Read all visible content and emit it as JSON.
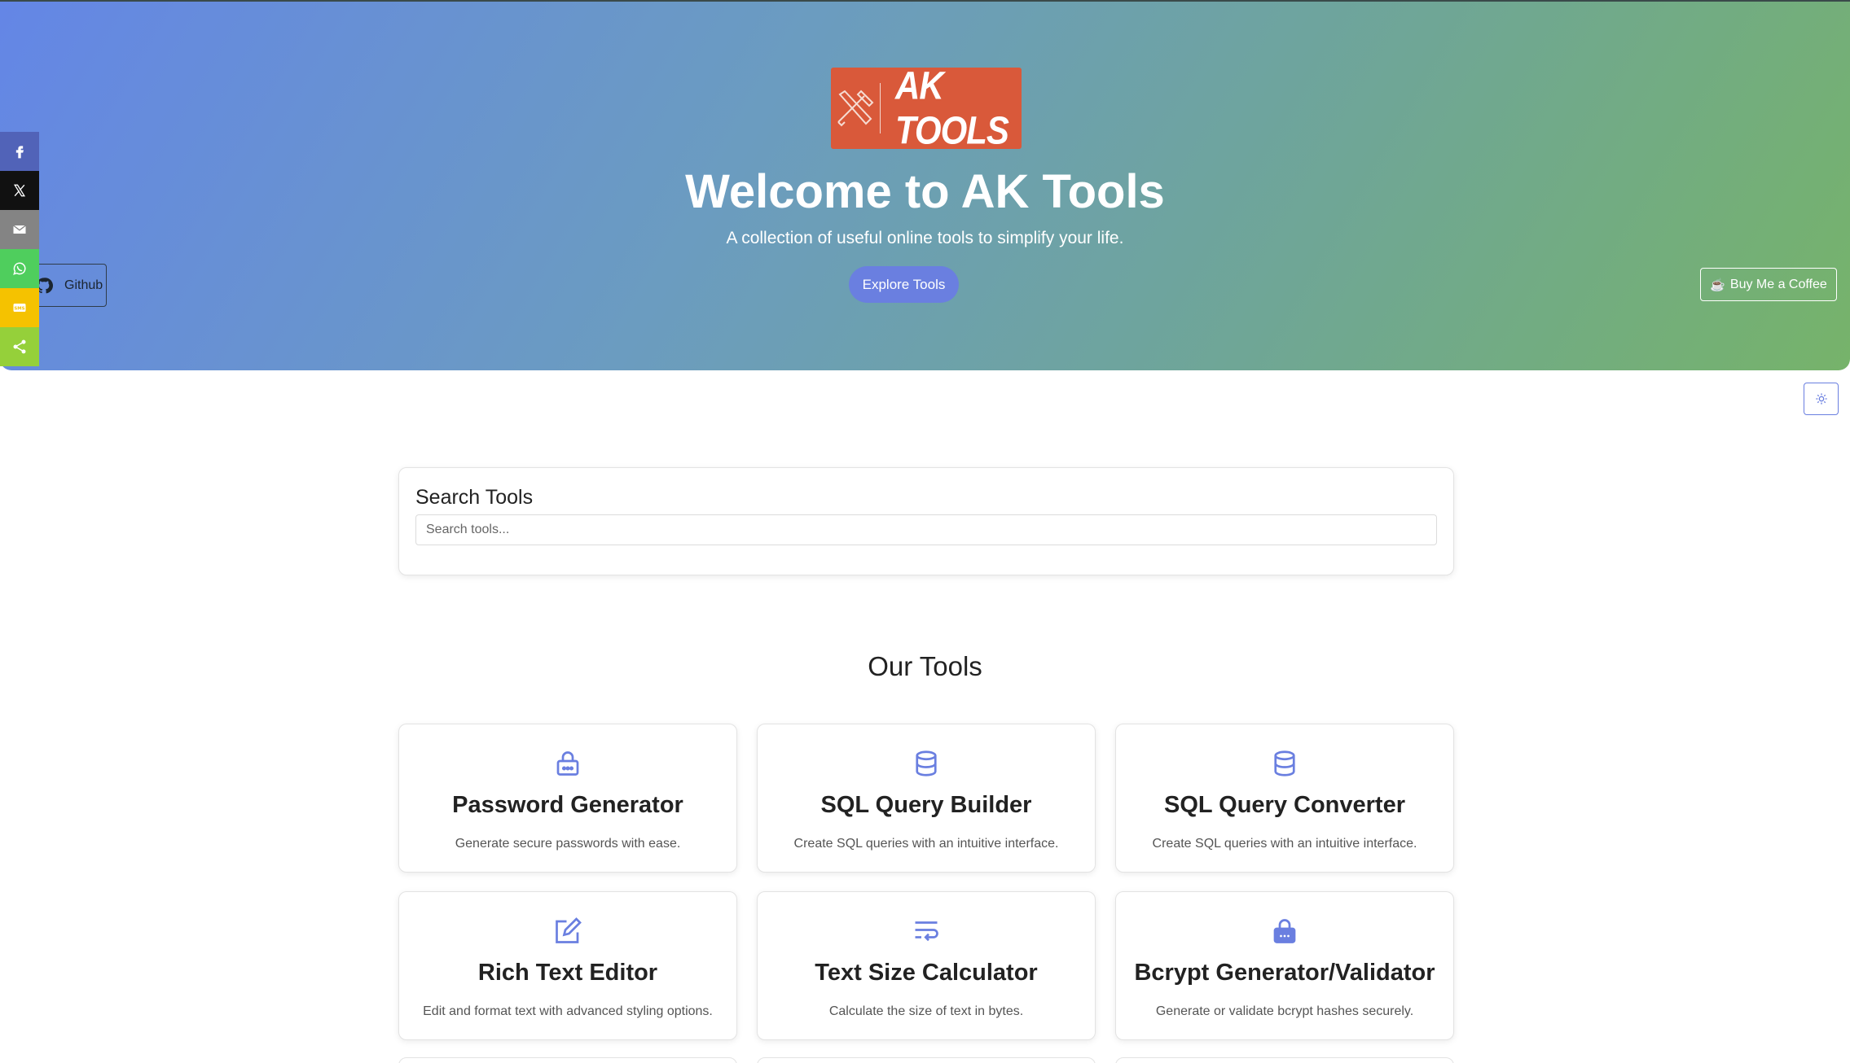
{
  "hero": {
    "logo_text": "AK TOOLS",
    "title": "Welcome to AK Tools",
    "subtitle": "A collection of useful online tools to simplify your life.",
    "explore_label": "Explore Tools",
    "github_label": "Github",
    "coffee_label": "Buy Me a Coffee"
  },
  "share": {
    "items": [
      {
        "icon": "facebook-icon",
        "color": "#5163b8"
      },
      {
        "icon": "x-icon",
        "color": "#111111"
      },
      {
        "icon": "email-icon",
        "color": "#848484"
      },
      {
        "icon": "whatsapp-icon",
        "color": "#4fce5d"
      },
      {
        "icon": "sms-icon",
        "color": "#f5c200"
      },
      {
        "icon": "share-icon",
        "color": "#95d03a"
      }
    ]
  },
  "search": {
    "title": "Search Tools",
    "placeholder": "Search tools..."
  },
  "tools_section": {
    "title": "Our Tools",
    "tools": [
      {
        "name": "Password Generator",
        "description": "Generate secure passwords with ease.",
        "icon": "lock-icon"
      },
      {
        "name": "SQL Query Builder",
        "description": "Create SQL queries with an intuitive interface.",
        "icon": "database-icon"
      },
      {
        "name": "SQL Query Converter",
        "description": "Create SQL queries with an intuitive interface.",
        "icon": "database-icon"
      },
      {
        "name": "Rich Text Editor",
        "description": "Edit and format text with advanced styling options.",
        "icon": "edit-icon"
      },
      {
        "name": "Text Size Calculator",
        "description": "Calculate the size of text in bytes.",
        "icon": "text-wrap-icon"
      },
      {
        "name": "Bcrypt Generator/Validator",
        "description": "Generate or validate bcrypt hashes securely.",
        "icon": "lock-filled-icon"
      }
    ]
  },
  "colors": {
    "accent": "#6a7fe0",
    "logo_bg": "#d9593a",
    "gradient_start": "#6486e6",
    "gradient_end": "#76b36a"
  }
}
